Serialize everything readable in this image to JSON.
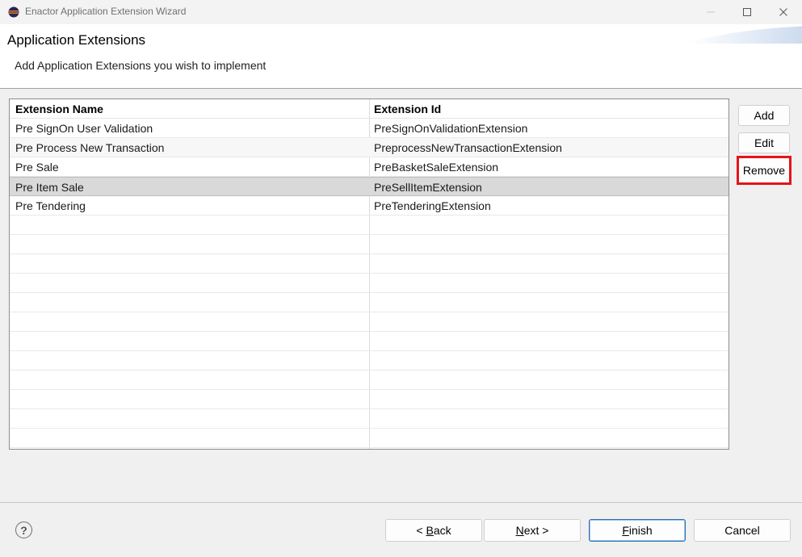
{
  "window": {
    "title": "Enactor Application Extension Wizard"
  },
  "header": {
    "title": "Application Extensions",
    "description": "Add Application Extensions you wish to implement"
  },
  "table": {
    "columns": [
      "Extension Name",
      "Extension Id"
    ],
    "rows": [
      {
        "name": "Pre SignOn User Validation",
        "id": "PreSignOnValidationExtension"
      },
      {
        "name": "Pre Process New Transaction",
        "id": "PreprocessNewTransactionExtension"
      },
      {
        "name": "Pre Sale",
        "id": "PreBasketSaleExtension"
      },
      {
        "name": "Pre Item Sale",
        "id": "PreSellItemExtension"
      },
      {
        "name": "Pre Tendering",
        "id": "PreTenderingExtension"
      }
    ],
    "selected_row": "Pre Item Sale"
  },
  "side_buttons": {
    "add": "Add",
    "edit": "Edit",
    "remove": "Remove"
  },
  "footer": {
    "help": "?",
    "back_prefix": "< ",
    "back_key": "B",
    "back_rest": "ack",
    "next_key": "N",
    "next_rest": "ext >",
    "finish_key": "F",
    "finish_rest": "inish",
    "cancel": "Cancel"
  },
  "colors": {
    "highlight_box": "#e3151a",
    "selected_row": "#d9d9d9",
    "default_button_border": "#2d6fb7"
  },
  "icons": {
    "app": "eclipse-icon",
    "minimize": "minimize-icon",
    "maximize": "maximize-icon",
    "close": "close-icon",
    "help": "help-icon"
  }
}
